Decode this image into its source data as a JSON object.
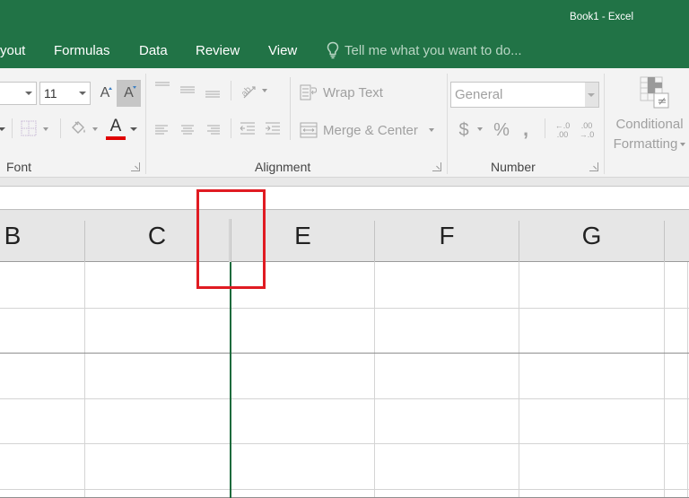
{
  "window": {
    "title": "Book1 - Excel"
  },
  "tabs": [
    {
      "label": "yout"
    },
    {
      "label": "Formulas"
    },
    {
      "label": "Data"
    },
    {
      "label": "Review"
    },
    {
      "label": "View"
    }
  ],
  "tell_me": {
    "icon": "lightbulb-icon",
    "placeholder": "Tell me what you want to do..."
  },
  "ribbon": {
    "font": {
      "label": "Font",
      "font_name_value": "",
      "font_size_value": "11",
      "increase_font_size_glyph": "A",
      "decrease_font_size_glyph": "A",
      "font_color_glyph": "A",
      "font_color": "#e00000"
    },
    "alignment": {
      "label": "Alignment",
      "wrap_text": "Wrap Text",
      "merge_center": "Merge & Center"
    },
    "number": {
      "label": "Number",
      "format_value": "General",
      "currency_glyph": "$",
      "percent_glyph": "%",
      "comma_glyph": ",",
      "increase_decimal_top": "←.0",
      "increase_decimal_bottom": ".00",
      "decrease_decimal_top": ".00",
      "decrease_decimal_bottom": "→.0"
    },
    "styles": {
      "conditional_formatting_line1": "Conditional",
      "conditional_formatting_line2": "Formatting"
    }
  },
  "sheet": {
    "columns": [
      "B",
      "C",
      "E",
      "F",
      "G"
    ],
    "resize_line_color": "#1e6b3d",
    "highlight_color": "#e01b22"
  },
  "colors": {
    "accent": "#217346"
  }
}
